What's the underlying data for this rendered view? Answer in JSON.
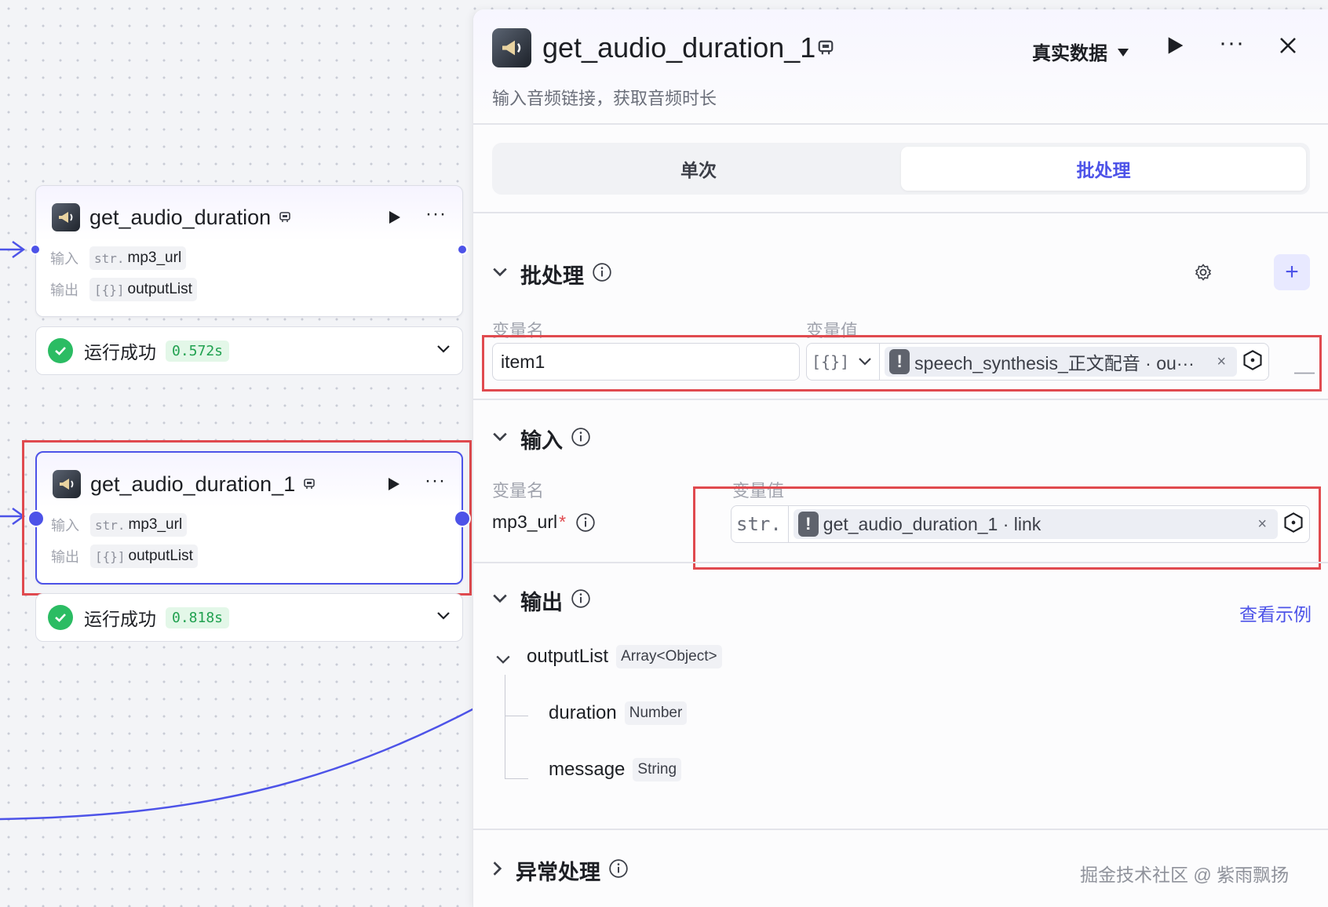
{
  "canvas": {
    "node1": {
      "title": "get_audio_duration",
      "input_label": "输入",
      "input_type": "str.",
      "input_value": "mp3_url",
      "output_label": "输出",
      "output_type": "[{}]",
      "output_value": "outputList",
      "status_text": "运行成功",
      "status_time": "0.572s"
    },
    "node2": {
      "title": "get_audio_duration_1",
      "input_label": "输入",
      "input_type": "str.",
      "input_value": "mp3_url",
      "output_label": "输出",
      "output_type": "[{}]",
      "output_value": "outputList",
      "status_text": "运行成功",
      "status_time": "0.818s"
    }
  },
  "panel": {
    "title": "get_audio_duration_1",
    "mode": "真实数据",
    "more": "···",
    "description": "输入音频链接，获取音频时长",
    "tabs": [
      {
        "label": "单次",
        "active": false
      },
      {
        "label": "批处理",
        "active": true
      }
    ],
    "batch": {
      "title": "批处理",
      "col_name": "变量名",
      "col_value": "变量值",
      "row": {
        "name": "item1",
        "type": "[{}]",
        "ref": "speech_synthesis_正文配音 · ou···",
        "clear": "×",
        "remove": "—"
      },
      "add": "+"
    },
    "input": {
      "title": "输入",
      "col_name": "变量名",
      "col_value": "变量值",
      "row": {
        "name": "mp3_url",
        "required": "*",
        "type": "str.",
        "ref": "get_audio_duration_1 · link",
        "clear": "×"
      }
    },
    "output": {
      "title": "输出",
      "example_link": "查看示例",
      "items": [
        {
          "name": "outputList",
          "type": "Array<Object>"
        },
        {
          "name": "duration",
          "type": "Number"
        },
        {
          "name": "message",
          "type": "String"
        }
      ]
    },
    "error": {
      "title": "异常处理"
    }
  },
  "watermark": "掘金技术社区 @ 紫雨飘扬",
  "colors": {
    "accent": "#4d53e8",
    "success": "#2bbc63",
    "highlight": "#e04a4f"
  }
}
